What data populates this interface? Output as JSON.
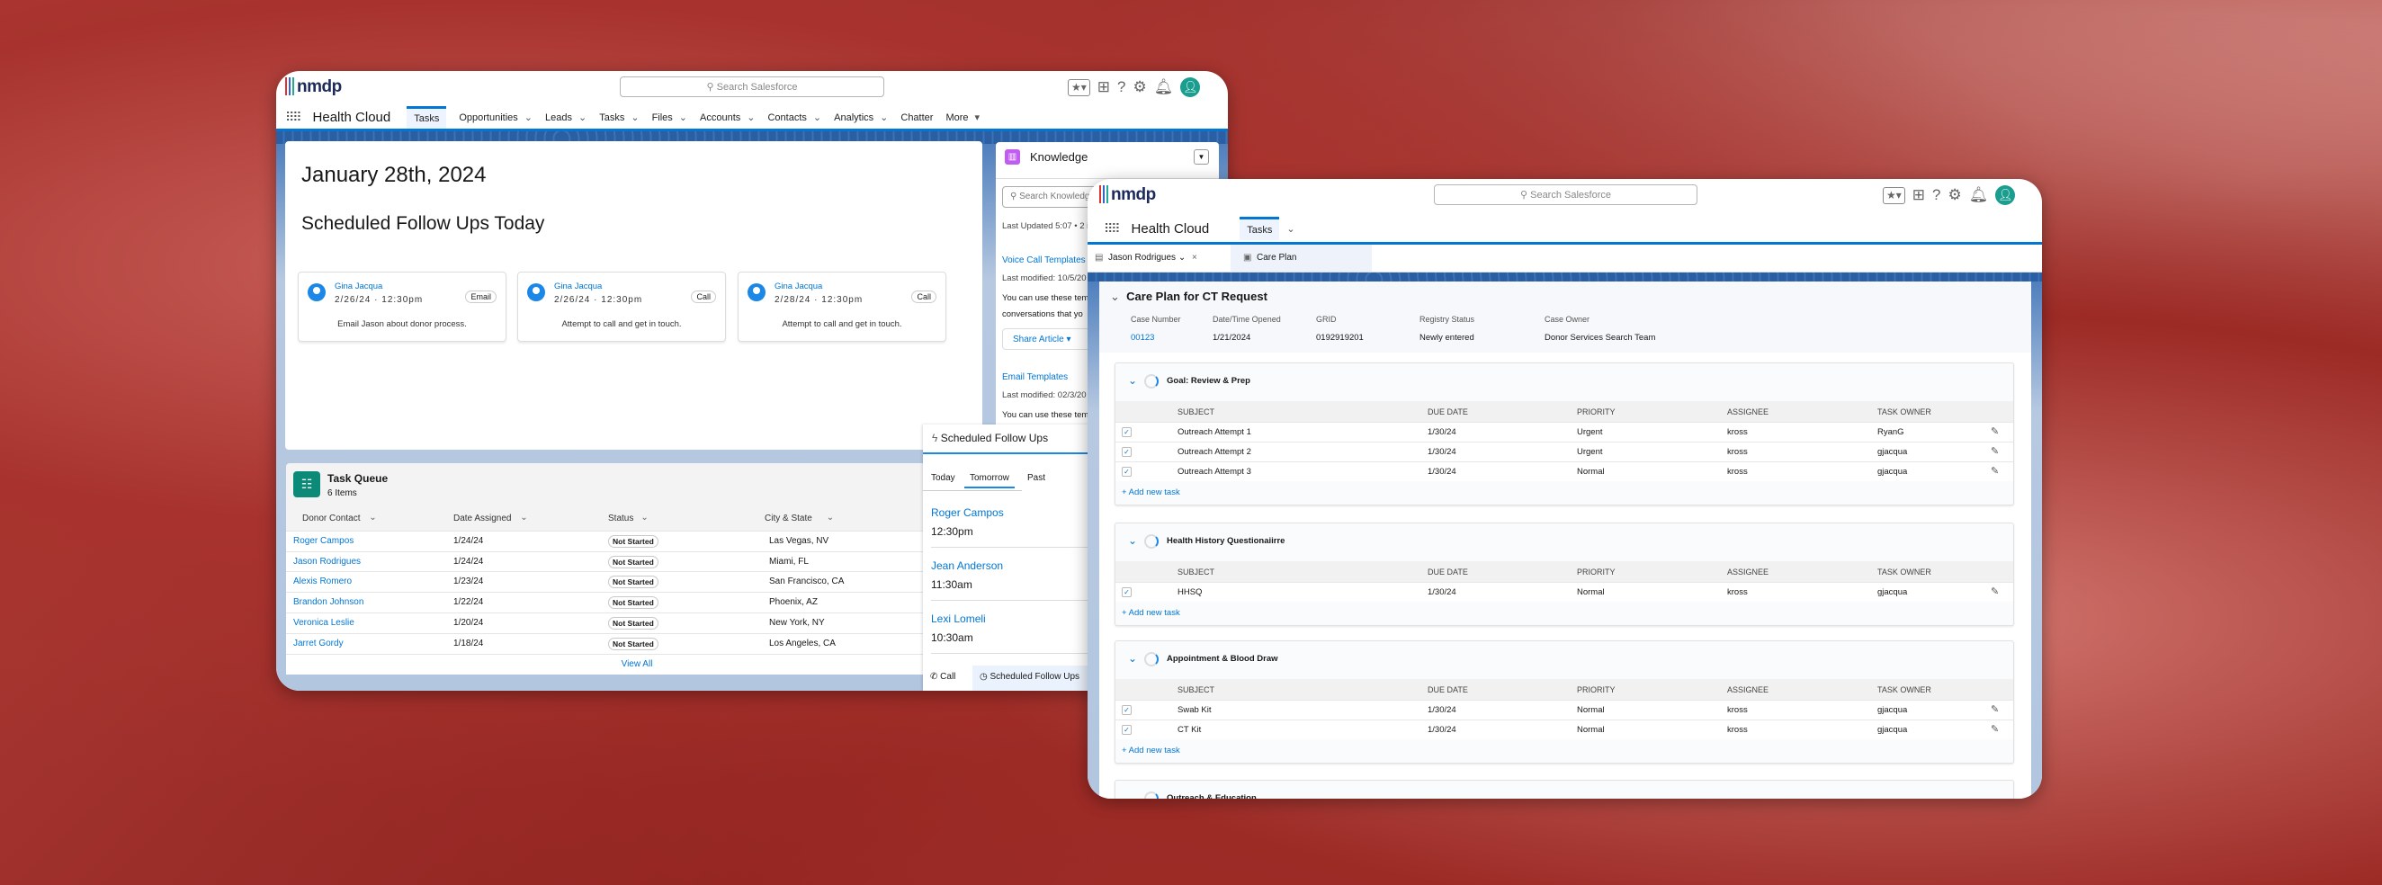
{
  "colors": {
    "accent": "#0176d3",
    "avatar": "#1b9e8f",
    "task_queue_icon": "#0b8a78",
    "knowledge_icon": "#c15cf0"
  },
  "left_window": {
    "logo": "nmdp",
    "search_placeholder": "Search Salesforce",
    "app_name": "Health Cloud",
    "nav": [
      {
        "label": "Tasks",
        "active": true
      },
      {
        "label": "Opportunities",
        "chevron": true
      },
      {
        "label": "Leads",
        "chevron": true
      },
      {
        "label": "Tasks",
        "chevron": true
      },
      {
        "label": "Files",
        "chevron": true
      },
      {
        "label": "Accounts",
        "chevron": true
      },
      {
        "label": "Contacts",
        "chevron": true
      },
      {
        "label": "Analytics",
        "chevron": true
      },
      {
        "label": "Chatter"
      },
      {
        "label": "More",
        "chevron": true
      }
    ],
    "date_title": "January 28th, 2024",
    "followups_title": "Scheduled Follow Ups Today",
    "followup_cards": [
      {
        "name": "Gina Jacqua",
        "datetime": "2/26/24 · 12:30pm",
        "type": "Email",
        "note": "Email Jason about donor process."
      },
      {
        "name": "Gina Jacqua",
        "datetime": "2/26/24 · 12:30pm",
        "type": "Call",
        "note": "Attempt to call and get in touch."
      },
      {
        "name": "Gina Jacqua",
        "datetime": "2/28/24 · 12:30pm",
        "type": "Call",
        "note": "Attempt to call and get in touch."
      }
    ],
    "knowledge": {
      "title": "Knowledge",
      "search_placeholder": "Search Knowledge",
      "last_updated": "Last Updated 5:07 • 2 it",
      "articles": [
        {
          "title": "Voice Call Templates",
          "modified": "Last modified: 10/5/20",
          "line1": "You can use these tem",
          "line2": "conversations that yo",
          "share": "Share Article"
        },
        {
          "title": "Email Templates",
          "modified": "Last modified: 02/3/20",
          "line1": "You can use these tem"
        }
      ]
    },
    "task_queue": {
      "title": "Task Queue",
      "count": "6 Items",
      "columns": [
        "Donor Contact",
        "Date Assigned",
        "Status",
        "City & State"
      ],
      "rows": [
        [
          "Roger Campos",
          "1/24/24",
          "Not Started",
          "Las Vegas, NV"
        ],
        [
          "Jason Rodrigues",
          "1/24/24",
          "Not Started",
          "Miami, FL"
        ],
        [
          "Alexis Romero",
          "1/23/24",
          "Not Started",
          "San Francisco, CA"
        ],
        [
          "Brandon Johnson",
          "1/22/24",
          "Not Started",
          "Phoenix, AZ"
        ],
        [
          "Veronica Leslie",
          "1/20/24",
          "Not Started",
          "New York, NY"
        ],
        [
          "Jarret Gordy",
          "1/18/24",
          "Not Started",
          "Los Angeles, CA"
        ]
      ],
      "view_all": "View All"
    },
    "scheduled_panel": {
      "title": "Scheduled Follow Ups",
      "tabs": [
        "Today",
        "Tomorrow",
        "Past"
      ],
      "active_tab": "Tomorrow",
      "items": [
        {
          "name": "Roger Campos",
          "time": "12:30pm"
        },
        {
          "name": "Jean Anderson",
          "time": "11:30am"
        },
        {
          "name": "Lexi Lomeli",
          "time": "10:30am"
        }
      ],
      "footer": [
        {
          "label": "Call",
          "icon": "phone-icon"
        },
        {
          "label": "Scheduled Follow Ups",
          "icon": "clock-icon",
          "active": true
        }
      ]
    }
  },
  "right_window": {
    "logo": "nmdp",
    "search_placeholder": "Search Salesforce",
    "app_name": "Health Cloud",
    "tab": "Tasks",
    "subtabs": [
      {
        "label": "Jason Rodrigues"
      },
      {
        "label": "Care Plan",
        "active": true
      }
    ],
    "care_plan": {
      "title": "Care Plan for CT Request",
      "fields": [
        {
          "label": "Case Number",
          "value": "00123",
          "link": true
        },
        {
          "label": "Date/Time Opened",
          "value": "1/21/2024"
        },
        {
          "label": "GRID",
          "value": "0192919201"
        },
        {
          "label": "Registry Status",
          "value": "Newly entered"
        },
        {
          "label": "Case Owner",
          "value": "Donor Services Search Team"
        }
      ],
      "columns": [
        "SUBJECT",
        "DUE DATE",
        "PRIORITY",
        "ASSIGNEE",
        "TASK OWNER"
      ],
      "add_task": "Add new task",
      "goals": [
        {
          "title": "Goal: Review & Prep",
          "tasks": [
            [
              "Outreach Attempt 1",
              "1/30/24",
              "Urgent",
              "kross",
              "RyanG"
            ],
            [
              "Outreach Attempt 2",
              "1/30/24",
              "Urgent",
              "kross",
              "gjacqua"
            ],
            [
              "Outreach Attempt 3",
              "1/30/24",
              "Normal",
              "kross",
              "gjacqua"
            ]
          ]
        },
        {
          "title": "Health History Questionaiirre",
          "tasks": [
            [
              "HHSQ",
              "1/30/24",
              "Normal",
              "kross",
              "gjacqua"
            ]
          ]
        },
        {
          "title": "Appointment & Blood Draw",
          "tasks": [
            [
              "Swab Kit",
              "1/30/24",
              "Normal",
              "kross",
              "gjacqua"
            ],
            [
              "CT Kit",
              "1/30/24",
              "Normal",
              "kross",
              "gjacqua"
            ]
          ]
        },
        {
          "title": "Outreach & Education",
          "tasks": []
        }
      ]
    }
  }
}
